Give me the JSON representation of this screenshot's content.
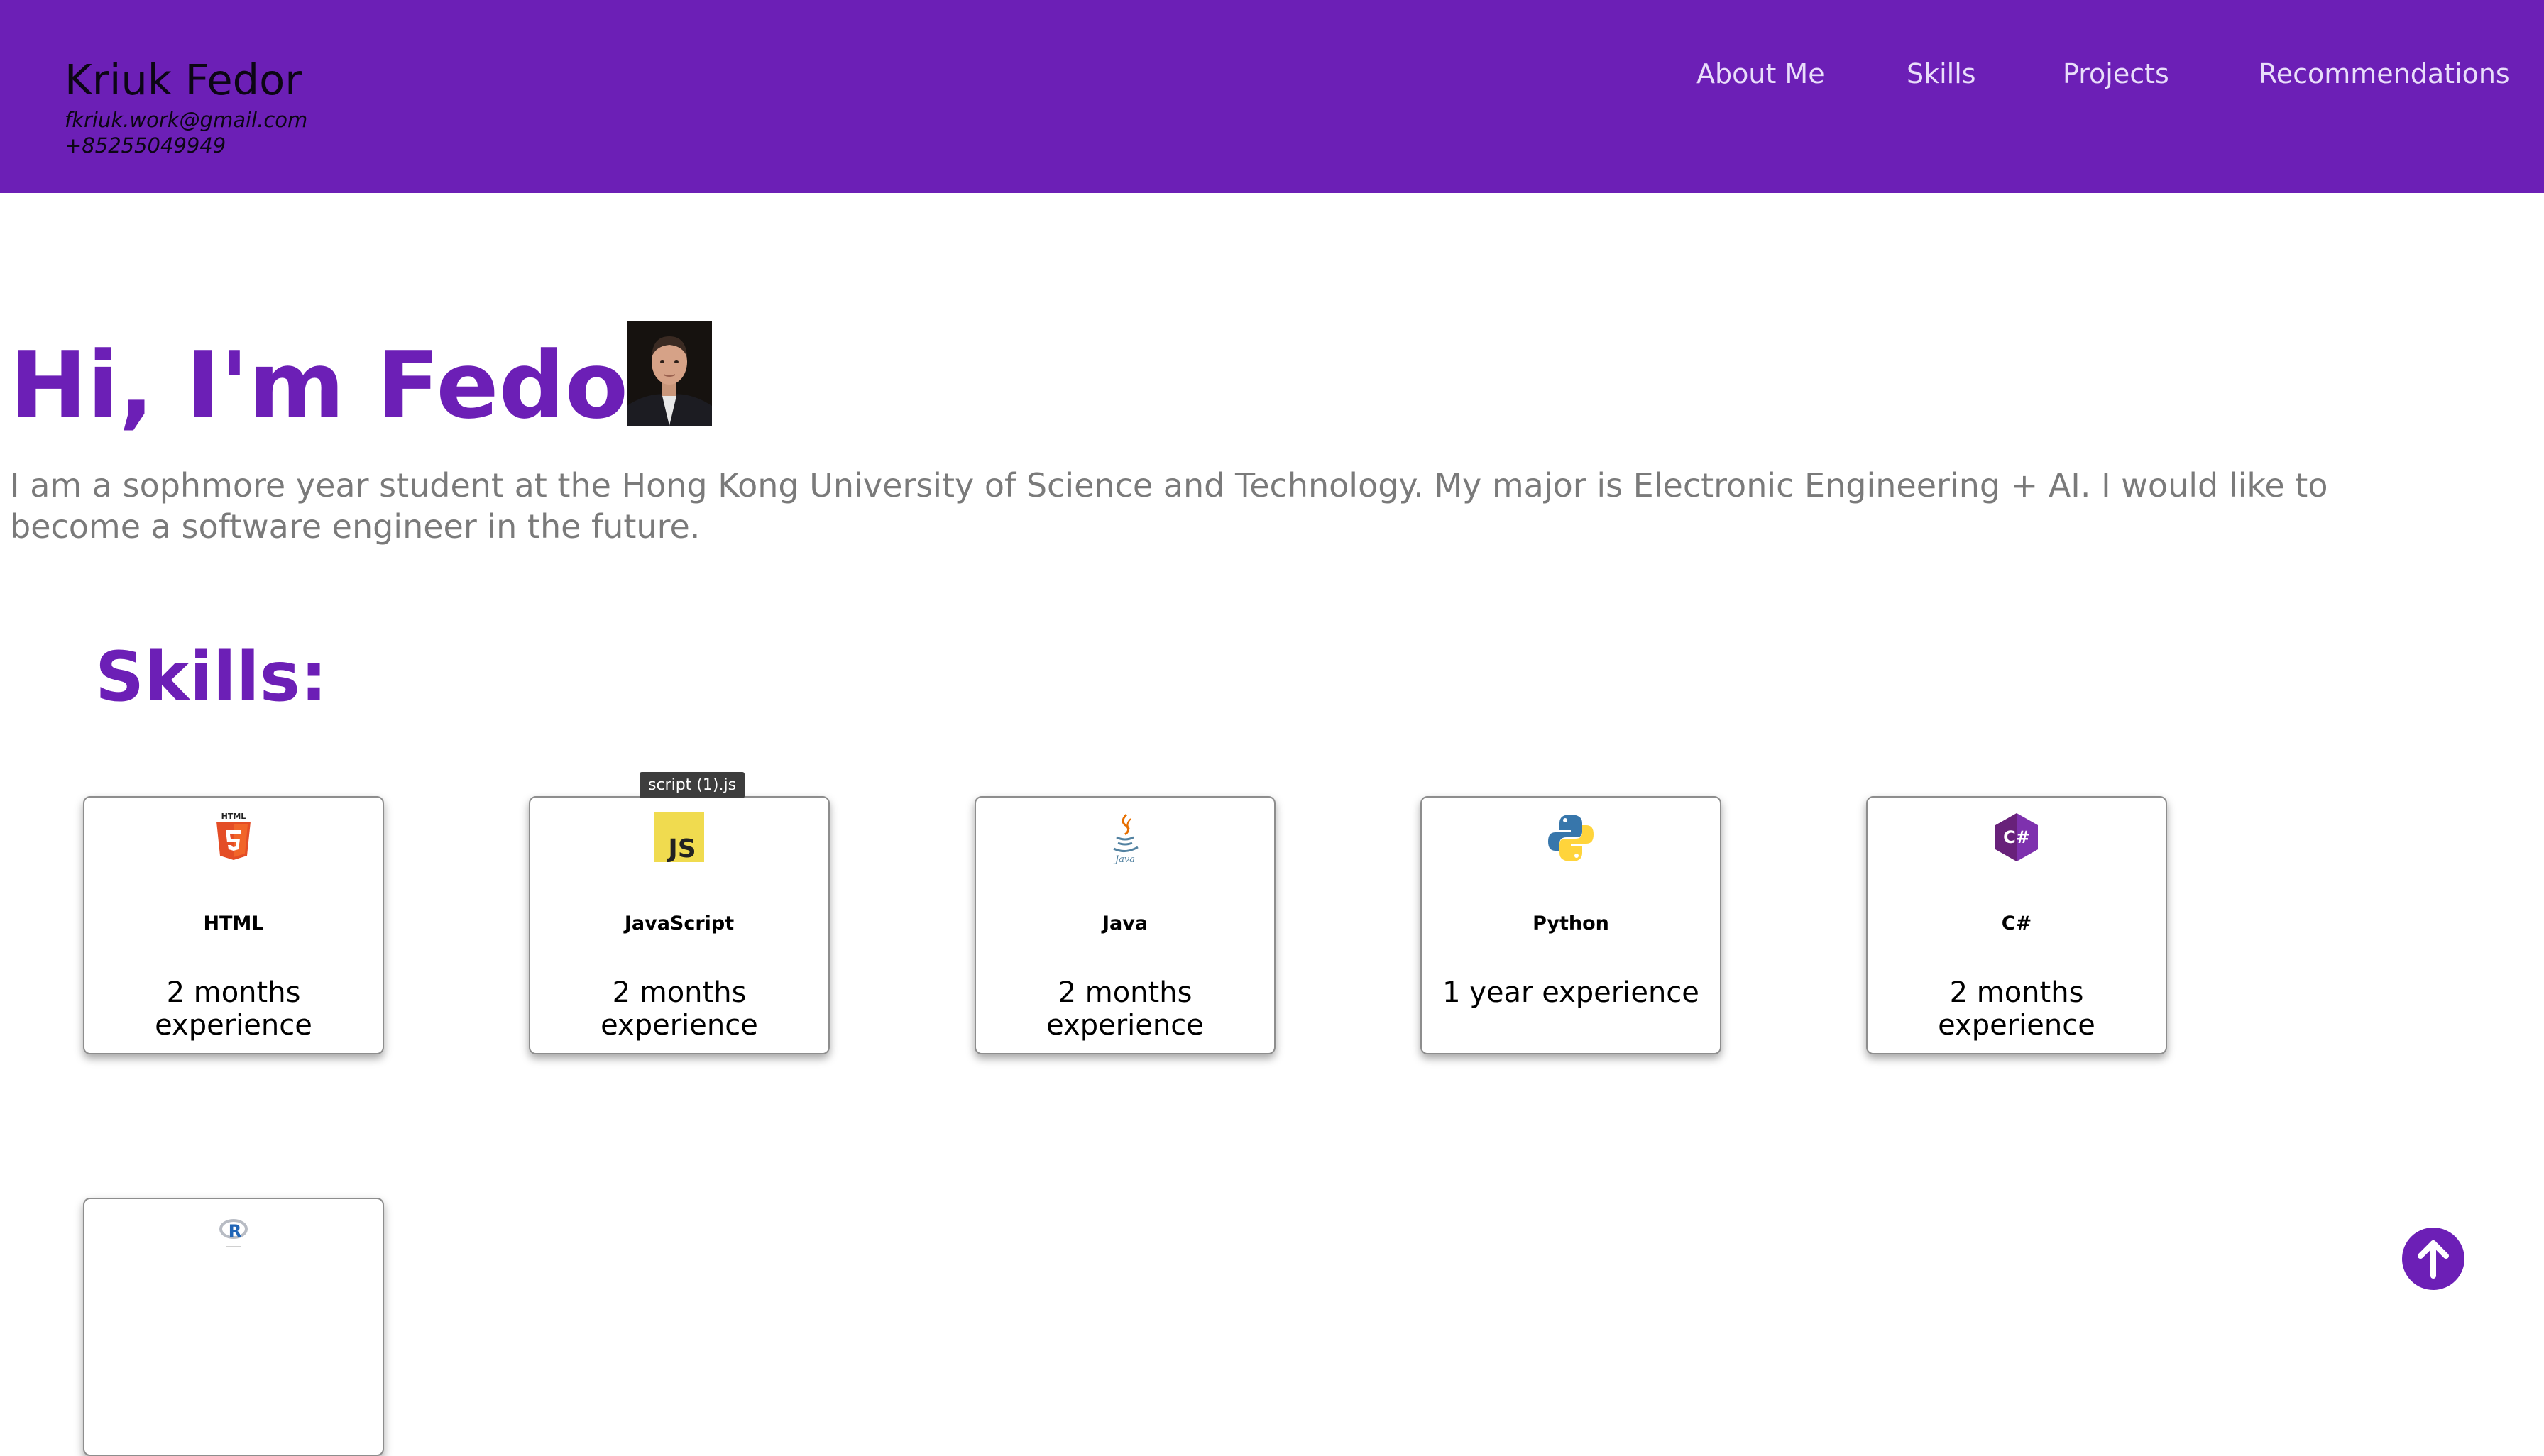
{
  "header": {
    "name": "Kriuk Fedor",
    "email": "fkriuk.work@gmail.com",
    "phone": "+85255049949",
    "nav": [
      "About Me",
      "Skills",
      "Projects",
      "Recommendations"
    ]
  },
  "hero": {
    "title": "Hi, I'm Fedor!",
    "description": "I am a sophmore year student at the Hong Kong University of Science and Technology. My major is Electronic Engineering + AI. I would like to become a software engineer in the future."
  },
  "skills": {
    "title": "Skills:",
    "items": [
      {
        "name": "HTML",
        "experience": "2 months experience",
        "icon": "html5-icon"
      },
      {
        "name": "JavaScript",
        "experience": "2 months experience",
        "icon": "javascript-icon"
      },
      {
        "name": "Java",
        "experience": "2 months experience",
        "icon": "java-icon"
      },
      {
        "name": "Python",
        "experience": "1 year experience",
        "icon": "python-icon"
      },
      {
        "name": "C#",
        "experience": "2 months experience",
        "icon": "csharp-icon"
      },
      {
        "name": "",
        "experience": "",
        "icon": "r-language-icon"
      }
    ]
  },
  "tooltip": "script (1).js",
  "colors": {
    "brand_purple": "#6c1fb6",
    "nav_text": "#e9defa",
    "description_text": "#7a7a7a"
  },
  "icons": {
    "scroll_top": "arrow-up-icon"
  }
}
